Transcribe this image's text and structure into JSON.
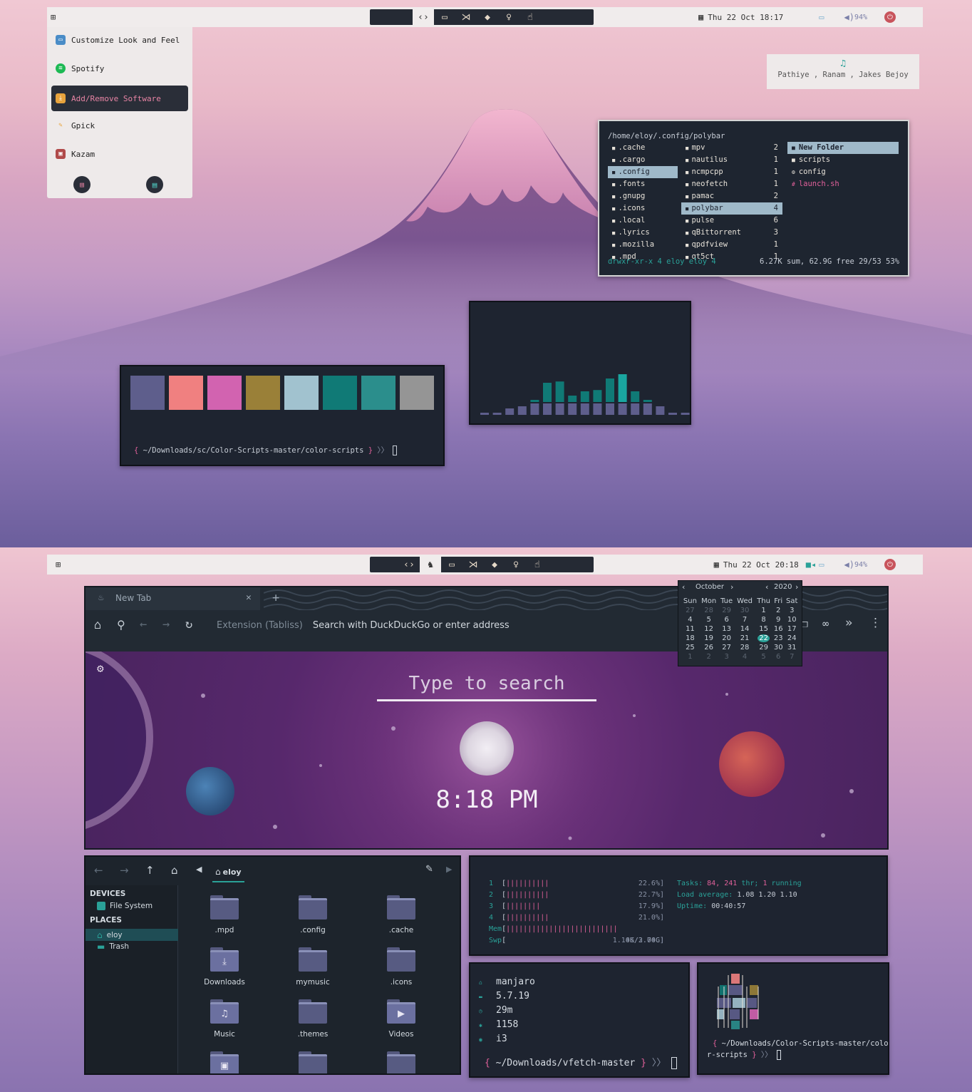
{
  "screen1": {
    "bar": {
      "datetime": "Thu 22 Oct 18:17",
      "volume": "94%",
      "icons": [
        "apps-icon",
        "code-icon",
        "image-icon",
        "vscode-icon",
        "diamond-icon",
        "bulb-icon",
        "hand-icon"
      ]
    },
    "menu": {
      "items": [
        {
          "label": "Customize Look and Feel",
          "icon": "monitor-icon"
        },
        {
          "label": "Spotify",
          "icon": "spotify-icon"
        },
        {
          "label": "Add/Remove Software",
          "icon": "download-icon"
        },
        {
          "label": "Gpick",
          "icon": "picker-icon"
        },
        {
          "label": "Kazam",
          "icon": "screen-record-icon"
        }
      ],
      "footer_icons": [
        "add-app-icon",
        "layout-icon"
      ]
    },
    "music": {
      "now_playing": "Pathiye , Ranam , Jakes Bejoy"
    },
    "ranger": {
      "path": "/home/eloy/.config/polybar",
      "col1": [
        ".cache",
        ".cargo",
        ".config",
        ".fonts",
        ".gnupg",
        ".icons",
        ".local",
        ".lyrics",
        ".mozilla",
        ".mpd"
      ],
      "col2": [
        {
          "name": "mpv",
          "count": "2"
        },
        {
          "name": "nautilus",
          "count": "1"
        },
        {
          "name": "ncmpcpp",
          "count": "1"
        },
        {
          "name": "neofetch",
          "count": "1"
        },
        {
          "name": "pamac",
          "count": "2"
        },
        {
          "name": "polybar",
          "count": "4"
        },
        {
          "name": "pulse",
          "count": "6"
        },
        {
          "name": "qBittorrent",
          "count": "3"
        },
        {
          "name": "qpdfview",
          "count": "1"
        },
        {
          "name": "qt5ct",
          "count": "1"
        }
      ],
      "col3": [
        {
          "name": "New Folder",
          "prefix": "■"
        },
        {
          "name": "scripts",
          "prefix": "■"
        },
        {
          "name": "config",
          "prefix": "⚙"
        },
        {
          "name": "launch.sh",
          "prefix": "#"
        }
      ],
      "status_left": "drwxr-xr-x 4 eloy eloy 4",
      "status_right": "6.27K sum, 62.9G free  29/53  53%"
    },
    "colors": {
      "swatches": [
        "#5e5e8c",
        "#f08080",
        "#d263b0",
        "#9a8038",
        "#a1c2cf",
        "#107a76",
        "#2b8e8c",
        "#959595"
      ],
      "prompt_open": "{",
      "prompt_path": "~/Downloads/sc/Color-Scripts-master/color-scripts",
      "prompt_close": "}",
      "prompt_arrow": "〉〉"
    },
    "visualizer": {
      "levels": [
        0.05,
        0.05,
        0.15,
        0.2,
        0.35,
        0.75,
        0.78,
        0.45,
        0.55,
        0.58,
        0.85,
        0.95,
        0.55,
        0.35,
        0.2,
        0.05,
        0.05
      ]
    }
  },
  "screen2": {
    "bar": {
      "datetime": "Thu 22 Oct 20:18",
      "volume": "94%"
    },
    "calendar": {
      "month": "October",
      "year": "2020",
      "weekdays": [
        "Sun",
        "Mon",
        "Tue",
        "Wed",
        "Thu",
        "Fri",
        "Sat"
      ],
      "weeks": [
        [
          "27",
          "28",
          "29",
          "30",
          "1",
          "2",
          "3"
        ],
        [
          "4",
          "5",
          "6",
          "7",
          "8",
          "9",
          "10"
        ],
        [
          "11",
          "12",
          "13",
          "14",
          "15",
          "16",
          "17"
        ],
        [
          "18",
          "19",
          "20",
          "21",
          "22",
          "23",
          "24"
        ],
        [
          "25",
          "26",
          "27",
          "28",
          "29",
          "30",
          "31"
        ],
        [
          "1",
          "2",
          "3",
          "4",
          "5",
          "6",
          "7"
        ]
      ],
      "today": "22"
    },
    "browser": {
      "tab_title": "New Tab",
      "url_prefix": "Extension (Tabliss)",
      "url_placeholder": "Search with DuckDuckGo or enter address",
      "search_placeholder": "Type to search",
      "clock": "8:18 PM"
    },
    "files": {
      "breadcrumb": "eloy",
      "devices_header": "DEVICES",
      "places_header": "PLACES",
      "devices": [
        "File System"
      ],
      "places": [
        "eloy",
        "Trash"
      ],
      "folders": [
        {
          "name": ".mpd",
          "emblem": ""
        },
        {
          "name": ".config",
          "emblem": ""
        },
        {
          "name": ".cache",
          "emblem": ""
        },
        {
          "name": "Downloads",
          "emblem": "⤓"
        },
        {
          "name": "mymusic",
          "emblem": ""
        },
        {
          "name": ".icons",
          "emblem": ""
        },
        {
          "name": "Music",
          "emblem": "♫"
        },
        {
          "name": ".themes",
          "emblem": ""
        },
        {
          "name": "Videos",
          "emblem": "▶"
        },
        {
          "name": "",
          "emblem": "▣"
        },
        {
          "name": "",
          "emblem": ""
        },
        {
          "name": "",
          "emblem": ""
        }
      ]
    },
    "htop": {
      "cpus": [
        {
          "id": "1",
          "bars": "||||||||||",
          "pct": "22.6%"
        },
        {
          "id": "2",
          "bars": "||||||||||",
          "pct": "22.7%"
        },
        {
          "id": "3",
          "bars": "||||||||",
          "pct": "17.9%"
        },
        {
          "id": "4",
          "bars": "||||||||||",
          "pct": "21.0%"
        }
      ],
      "mem_label": "Mem",
      "mem_bars": "||||||||||||||||||||||||||",
      "mem_value": "1.14G/3.74G",
      "swp_label": "Swp",
      "swp_value": "0K/2.00G",
      "tasks_label": "Tasks:",
      "tasks_value": "84,",
      "thr_value": "241",
      "thr_label": "thr;",
      "running_value": "1",
      "running_label": "running",
      "load_label": "Load average:",
      "load_values": "1.08 1.20 1.10",
      "uptime_label": "Uptime:",
      "uptime_value": "00:40:57"
    },
    "vfetch": {
      "lines": [
        "manjaro",
        "5.7.19",
        "29m",
        "1158",
        "i3"
      ],
      "prompt_open": "{",
      "prompt_path": "~/Downloads/vfetch-master",
      "prompt_close": "}",
      "prompt_arrow": "〉〉"
    },
    "colorterm": {
      "prompt_line1": "~/Downloads/Color-Scripts-master/colo",
      "prompt_line2": "r-scripts",
      "prompt_open": "{",
      "prompt_close": "}",
      "prompt_arrow": "〉〉"
    }
  }
}
